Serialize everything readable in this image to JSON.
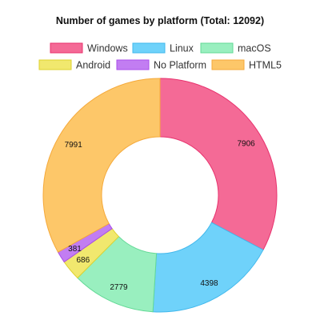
{
  "chart_data": {
    "type": "pie",
    "subtype": "doughnut",
    "title": "Number of games by platform (Total: 12092)",
    "legend_position": "top",
    "categories": [
      "Windows",
      "Linux",
      "macOS",
      "Android",
      "No Platform",
      "HTML5"
    ],
    "values": [
      7906,
      4398,
      2779,
      686,
      381,
      7991
    ],
    "data_labels": [
      "7906",
      "4398",
      "2779",
      "686",
      "381",
      "7991"
    ],
    "colors": {
      "fill": [
        "#f46a96",
        "#6fd2fa",
        "#99efbf",
        "#f1e86e",
        "#c27df2",
        "#fdc769"
      ],
      "stroke": [
        "#e8326e",
        "#42b8ec",
        "#63d996",
        "#dfd22f",
        "#a94ee9",
        "#f5a93a"
      ]
    }
  }
}
